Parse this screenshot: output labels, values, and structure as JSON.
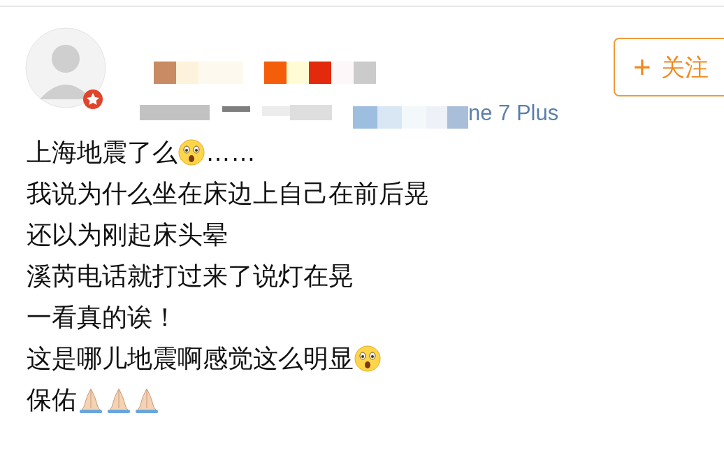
{
  "follow_button": {
    "icon": "+",
    "label": "关注"
  },
  "meta": {
    "source_tail": "ne 7 Plus"
  },
  "lines": [
    {
      "segments": [
        {
          "kind": "text",
          "text": "上海地震了么"
        },
        {
          "kind": "face"
        },
        {
          "kind": "text",
          "text": "……"
        }
      ]
    },
    {
      "segments": [
        {
          "kind": "text",
          "text": "我说为什么坐在床边上自己在前后晃"
        }
      ]
    },
    {
      "segments": [
        {
          "kind": "text",
          "text": "还以为刚起床头晕"
        }
      ]
    },
    {
      "segments": [
        {
          "kind": "text",
          "text": "溪芮电话就打过来了说灯在晃"
        }
      ]
    },
    {
      "segments": [
        {
          "kind": "text",
          "text": "一看真的诶！"
        }
      ]
    },
    {
      "segments": [
        {
          "kind": "text",
          "text": "这是哪儿地震啊感觉这么明显"
        },
        {
          "kind": "face"
        }
      ]
    },
    {
      "segments": [
        {
          "kind": "text",
          "text": "保佑"
        },
        {
          "kind": "hands"
        },
        {
          "kind": "hands"
        },
        {
          "kind": "hands"
        }
      ]
    }
  ]
}
